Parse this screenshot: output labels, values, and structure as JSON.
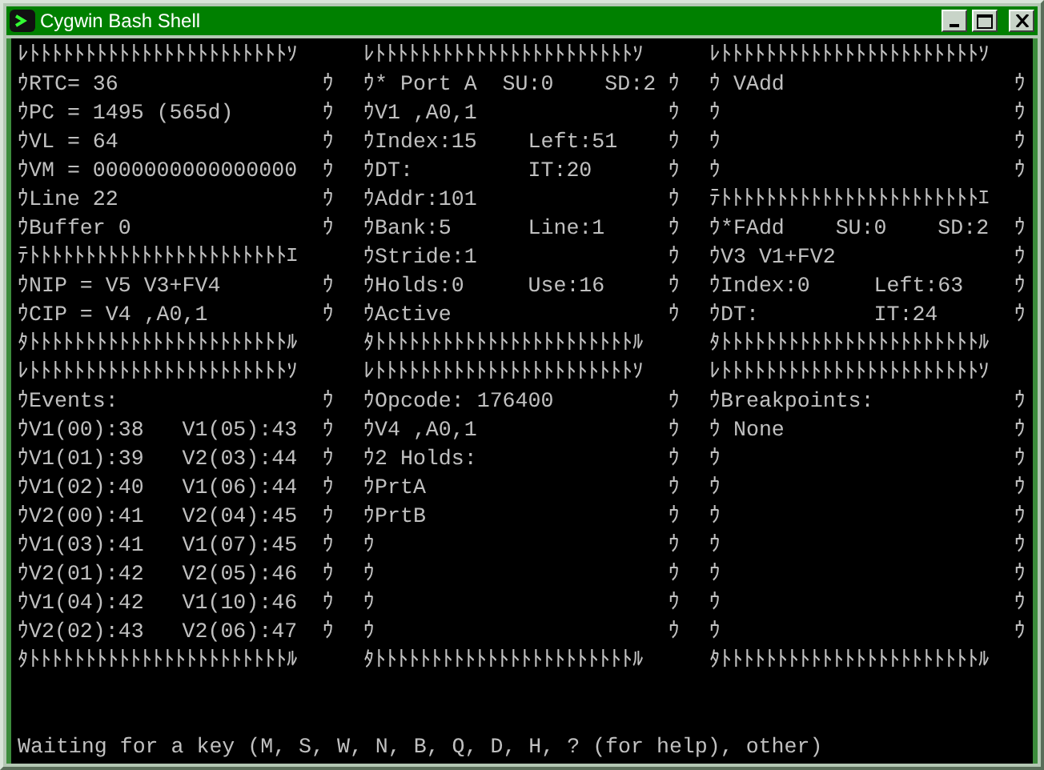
{
  "window": {
    "title": "Cygwin Bash Shell"
  },
  "rows": [
    [
      "ﾚﾄﾄﾄﾄﾄﾄﾄﾄﾄﾄﾄﾄﾄﾄﾄﾄﾄﾄﾄﾄﾄﾄﾄｿ",
      "ﾚﾄﾄﾄﾄﾄﾄﾄﾄﾄﾄﾄﾄﾄﾄﾄﾄﾄﾄﾄﾄﾄﾄﾄｿ",
      "ﾚﾄﾄﾄﾄﾄﾄﾄﾄﾄﾄﾄﾄﾄﾄﾄﾄﾄﾄﾄﾄﾄﾄﾄｿ"
    ],
    [
      "ｳRTC= 36                ｳ",
      "ｳ* Port A  SU:0    SD:2 ｳ",
      "ｳ VAdd                  ｳ"
    ],
    [
      "ｳPC = 1495 (565d)       ｳ",
      "ｳV1 ,A0,1               ｳ",
      "ｳ                       ｳ"
    ],
    [
      "ｳVL = 64                ｳ",
      "ｳIndex:15    Left:51    ｳ",
      "ｳ                       ｳ"
    ],
    [
      "ｳVM = 0000000000000000  ｳ",
      "ｳDT:         IT:20      ｳ",
      "ｳ                       ｳ"
    ],
    [
      "ｳLine 22                ｳ",
      "ｳAddr:101               ｳ",
      "ﾃﾄﾄﾄﾄﾄﾄﾄﾄﾄﾄﾄﾄﾄﾄﾄﾄﾄﾄﾄﾄﾄﾄﾄｴ"
    ],
    [
      "ｳBuffer 0               ｳ",
      "ｳBank:5      Line:1     ｳ",
      "ｳ*FAdd    SU:0    SD:2  ｳ"
    ],
    [
      "ﾃﾄﾄﾄﾄﾄﾄﾄﾄﾄﾄﾄﾄﾄﾄﾄﾄﾄﾄﾄﾄﾄﾄﾄｴ",
      "ｳStride:1               ｳ",
      "ｳV3 V1+FV2              ｳ"
    ],
    [
      "ｳNIP = V5 V3+FV4        ｳ",
      "ｳHolds:0     Use:16     ｳ",
      "ｳIndex:0     Left:63    ｳ"
    ],
    [
      "ｳCIP = V4 ,A0,1         ｳ",
      "ｳActive                 ｳ",
      "ｳDT:         IT:24      ｳ"
    ],
    [
      "ﾀﾄﾄﾄﾄﾄﾄﾄﾄﾄﾄﾄﾄﾄﾄﾄﾄﾄﾄﾄﾄﾄﾄﾄﾙ",
      "ﾀﾄﾄﾄﾄﾄﾄﾄﾄﾄﾄﾄﾄﾄﾄﾄﾄﾄﾄﾄﾄﾄﾄﾄﾙ",
      "ﾀﾄﾄﾄﾄﾄﾄﾄﾄﾄﾄﾄﾄﾄﾄﾄﾄﾄﾄﾄﾄﾄﾄﾄﾙ"
    ],
    [
      "ﾚﾄﾄﾄﾄﾄﾄﾄﾄﾄﾄﾄﾄﾄﾄﾄﾄﾄﾄﾄﾄﾄﾄﾄｿ",
      "ﾚﾄﾄﾄﾄﾄﾄﾄﾄﾄﾄﾄﾄﾄﾄﾄﾄﾄﾄﾄﾄﾄﾄﾄｿ",
      "ﾚﾄﾄﾄﾄﾄﾄﾄﾄﾄﾄﾄﾄﾄﾄﾄﾄﾄﾄﾄﾄﾄﾄﾄｿ"
    ],
    [
      "ｳEvents:                ｳ",
      "ｳOpcode: 176400         ｳ",
      "ｳBreakpoints:           ｳ"
    ],
    [
      "ｳV1(00):38   V1(05):43  ｳ",
      "ｳV4 ,A0,1               ｳ",
      "ｳ None                  ｳ"
    ],
    [
      "ｳV1(01):39   V2(03):44  ｳ",
      "ｳ2 Holds:               ｳ",
      "ｳ                       ｳ"
    ],
    [
      "ｳV1(02):40   V1(06):44  ｳ",
      "ｳPrtA                   ｳ",
      "ｳ                       ｳ"
    ],
    [
      "ｳV2(00):41   V2(04):45  ｳ",
      "ｳPrtB                   ｳ",
      "ｳ                       ｳ"
    ],
    [
      "ｳV1(03):41   V1(07):45  ｳ",
      "ｳ                       ｳ",
      "ｳ                       ｳ"
    ],
    [
      "ｳV2(01):42   V2(05):46  ｳ",
      "ｳ                       ｳ",
      "ｳ                       ｳ"
    ],
    [
      "ｳV1(04):42   V1(10):46  ｳ",
      "ｳ                       ｳ",
      "ｳ                       ｳ"
    ],
    [
      "ｳV2(02):43   V2(06):47  ｳ",
      "ｳ                       ｳ",
      "ｳ                       ｳ"
    ],
    [
      "ﾀﾄﾄﾄﾄﾄﾄﾄﾄﾄﾄﾄﾄﾄﾄﾄﾄﾄﾄﾄﾄﾄﾄﾄﾙ",
      "ﾀﾄﾄﾄﾄﾄﾄﾄﾄﾄﾄﾄﾄﾄﾄﾄﾄﾄﾄﾄﾄﾄﾄﾄﾙ",
      "ﾀﾄﾄﾄﾄﾄﾄﾄﾄﾄﾄﾄﾄﾄﾄﾄﾄﾄﾄﾄﾄﾄﾄﾄﾙ"
    ]
  ],
  "prompt": "Waiting for a key (M, S, W, N, B, Q, D, H, ? (for help), other)"
}
